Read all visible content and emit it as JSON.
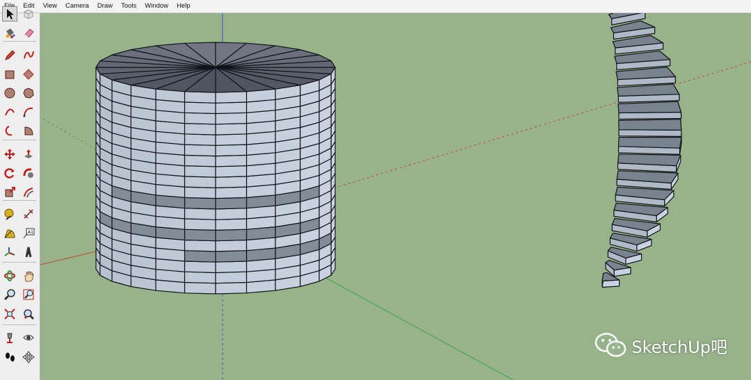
{
  "menu": [
    "File",
    "Edit",
    "View",
    "Camera",
    "Draw",
    "Tools",
    "Window",
    "Help"
  ],
  "colors": {
    "viewport_bg": "#98b28a",
    "face_light": "#c9d3df",
    "face_dark": "#5c6670",
    "face_mid": "#838d97",
    "edge": "#101418",
    "axis_red": "#c44a3a",
    "axis_green": "#3aa84a",
    "axis_blue": "#3a55cc"
  },
  "toolbar_icons": [
    [
      "select-icon",
      "component-icon"
    ],
    [
      "paint-bucket-icon",
      "eraser-icon"
    ],
    [
      "pencil-icon",
      "freehand-icon"
    ],
    [
      "rectangle-icon",
      "rotated-rectangle-icon"
    ],
    [
      "circle-icon",
      "polygon-icon"
    ],
    [
      "arc-icon",
      "two-point-arc-icon"
    ],
    [
      "three-point-arc-icon",
      "pie-icon"
    ],
    [
      "move-icon",
      "push-pull-icon"
    ],
    [
      "rotate-icon",
      "follow-me-icon"
    ],
    [
      "scale-icon",
      "offset-icon"
    ],
    [
      "tape-measure-icon",
      "dimension-icon"
    ],
    [
      "protractor-icon",
      "text-icon"
    ],
    [
      "axes-icon",
      "3d-text-icon"
    ],
    [
      "orbit-icon",
      "pan-icon"
    ],
    [
      "zoom-icon",
      "zoom-window-icon"
    ],
    [
      "zoom-extents-icon",
      "previous-view-icon"
    ],
    [
      "position-camera-icon",
      "look-around-icon"
    ],
    [
      "walk-icon",
      "section-plane-icon"
    ]
  ],
  "watermark": {
    "text": "SketchUp吧"
  }
}
